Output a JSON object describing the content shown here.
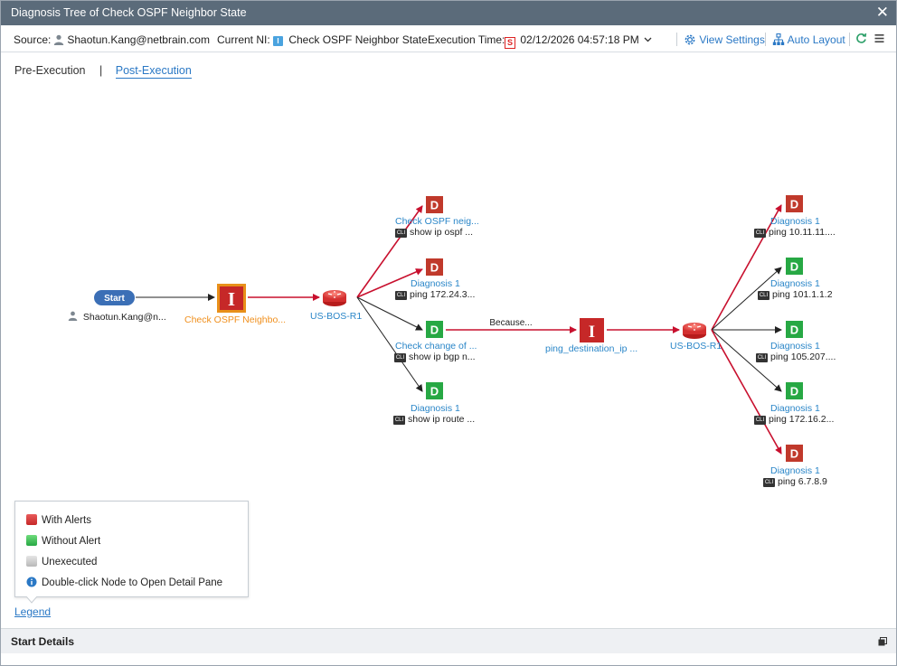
{
  "window": {
    "title": "Diagnosis Tree of Check OSPF Neighbor State"
  },
  "infobar": {
    "source_label": "Source:",
    "source_user": "Shaotun.Kang@netbrain.com",
    "ni_label": "Current NI:",
    "ni_badge": "I",
    "ni_value": "Check OSPF Neighbor State",
    "exec_label": "Execution Time:",
    "exec_badge": "S",
    "exec_value": "02/12/2026 04:57:18 PM",
    "view_settings": "View Settings",
    "auto_layout": "Auto Layout"
  },
  "tabs": {
    "pre": "Pre-Execution",
    "separator": "|",
    "post": "Post-Execution"
  },
  "tree": {
    "start": {
      "label": "Start",
      "user": "Shaotun.Kang@n..."
    },
    "ni1": {
      "glyph": "I",
      "label": "Check OSPF Neighbo..."
    },
    "device1": {
      "label": "US-BOS-R1"
    },
    "diag_left": [
      {
        "glyph": "D",
        "status": "alert",
        "title": "Check OSPF neig...",
        "cli_badge": "CLI",
        "command": "show ip ospf ..."
      },
      {
        "glyph": "D",
        "status": "alert",
        "title": "Diagnosis 1",
        "cli_badge": "CLI",
        "command": "ping 172.24.3..."
      },
      {
        "glyph": "D",
        "status": "ok",
        "title": "Check change of ...",
        "cli_badge": "CLI",
        "command": "show ip bgp n..."
      },
      {
        "glyph": "D",
        "status": "ok",
        "title": "Diagnosis 1",
        "cli_badge": "CLI",
        "command": "show ip route ..."
      }
    ],
    "because_label": "Because...",
    "ni2": {
      "glyph": "I",
      "label": "ping_destination_ip ..."
    },
    "device2": {
      "label": "US-BOS-R1"
    },
    "diag_right": [
      {
        "glyph": "D",
        "status": "alert",
        "title": "Diagnosis 1",
        "cli_badge": "CLI",
        "command": "ping 10.11.11...."
      },
      {
        "glyph": "D",
        "status": "ok",
        "title": "Diagnosis 1",
        "cli_badge": "CLI",
        "command": "ping 101.1.1.2"
      },
      {
        "glyph": "D",
        "status": "ok",
        "title": "Diagnosis 1",
        "cli_badge": "CLI",
        "command": "ping 105.207...."
      },
      {
        "glyph": "D",
        "status": "ok",
        "title": "Diagnosis 1",
        "cli_badge": "CLI",
        "command": "ping 172.16.2..."
      },
      {
        "glyph": "D",
        "status": "alert",
        "title": "Diagnosis 1",
        "cli_badge": "CLI",
        "command": "ping 6.7.8.9"
      }
    ]
  },
  "legend": {
    "with_alerts": "With Alerts",
    "without_alert": "Without Alert",
    "unexecuted": "Unexecuted",
    "tip": "Double-click Node to Open Detail Pane",
    "link": "Legend"
  },
  "bottom": {
    "title": "Start Details"
  },
  "colors": {
    "titlebar": "#5b6b7a",
    "link": "#2a78c5",
    "alert": "#c0392b",
    "ok": "#27a844",
    "unexecuted": "#c8c8c8",
    "edge_alert": "#c8102e",
    "node_label": "#2a86c8",
    "ni_label": "#f0901e"
  },
  "icons": [
    "person-icon",
    "ni-icon",
    "schedule-icon",
    "chevron-down-icon",
    "gear-icon",
    "auto-layout-icon",
    "refresh-icon",
    "menu-icon",
    "close-icon",
    "router-icon",
    "cli-icon",
    "info-icon",
    "restore-icon"
  ]
}
